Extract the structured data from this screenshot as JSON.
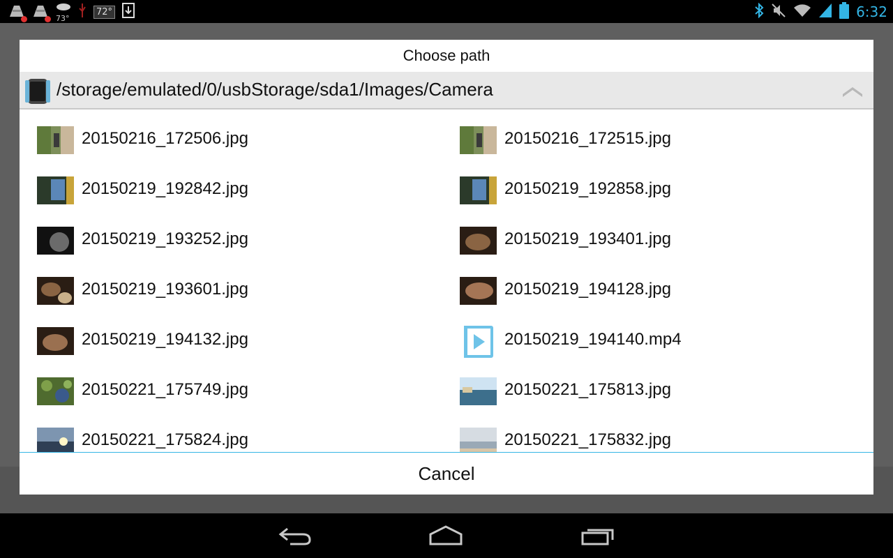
{
  "status_bar": {
    "left_icons": [
      "notification-alert-icon",
      "notification-alert-icon",
      "weather-icon",
      "usb-icon",
      "temperature-badge",
      "download-icon"
    ],
    "weather_temp": "73°",
    "temp_badge": "72°",
    "right_icons": [
      "bluetooth-icon",
      "mute-icon",
      "wifi-icon",
      "signal-icon",
      "battery-icon"
    ],
    "time": "6:32",
    "accent": "#33b5e5"
  },
  "dialog": {
    "title": "Choose path",
    "path": "/storage/emulated/0/usbStorage/sda1/Images/Camera",
    "cancel_label": "Cancel",
    "files": [
      {
        "name": "20150216_172506.jpg",
        "thumb": "thumb-road"
      },
      {
        "name": "20150216_172515.jpg",
        "thumb": "thumb-road"
      },
      {
        "name": "20150219_192842.jpg",
        "thumb": "thumb-blue"
      },
      {
        "name": "20150219_192858.jpg",
        "thumb": "thumb-blue"
      },
      {
        "name": "20150219_193252.jpg",
        "thumb": "thumb-dark"
      },
      {
        "name": "20150219_193401.jpg",
        "thumb": "thumb-brown"
      },
      {
        "name": "20150219_193601.jpg",
        "thumb": "thumb-brown"
      },
      {
        "name": "20150219_194128.jpg",
        "thumb": "thumb-brown"
      },
      {
        "name": "20150219_194132.jpg",
        "thumb": "thumb-brown"
      },
      {
        "name": "20150219_194140.mp4",
        "thumb": "video-icon"
      },
      {
        "name": "20150221_175749.jpg",
        "thumb": "thumb-green"
      },
      {
        "name": "20150221_175813.jpg",
        "thumb": "thumb-sea"
      },
      {
        "name": "20150221_175824.jpg",
        "thumb": "thumb-sunset"
      },
      {
        "name": "20150221_175832.jpg",
        "thumb": "thumb-beach"
      }
    ]
  },
  "nav_bar": {
    "buttons": [
      "back-icon",
      "home-icon",
      "recent-apps-icon"
    ]
  }
}
